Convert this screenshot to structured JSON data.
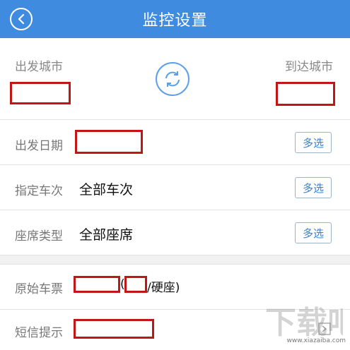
{
  "header": {
    "title": "监控设置"
  },
  "cities": {
    "from_label": "出发城市",
    "to_label": "到达城市"
  },
  "rows": {
    "date_label": "出发日期",
    "train_label": "指定车次",
    "train_value": "全部车次",
    "seat_label": "座席类型",
    "seat_value": "全部座席",
    "multi_label": "多选"
  },
  "ticket": {
    "label": "原始车票",
    "paren_open": "(",
    "suffix": "/硬座)"
  },
  "sms": {
    "label": "短信提示"
  },
  "watermark": {
    "logo": "下载吧",
    "site": "www.xiazaiba.com"
  },
  "colors": {
    "header_bg": "#3f8be0",
    "redaction": "#c21515",
    "accent": "#3f7fc8"
  }
}
